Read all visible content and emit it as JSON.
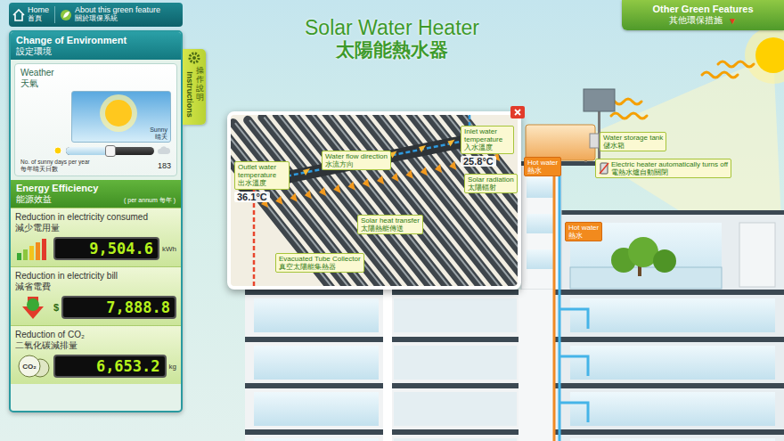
{
  "nav": [
    {
      "label": "Home",
      "label_zh": "首頁",
      "kind": "home"
    },
    {
      "label": "About this green feature",
      "label_zh": "關於環保系統",
      "kind": "about"
    }
  ],
  "title": {
    "en": "Solar Water Heater",
    "zh": "太陽能熱水器"
  },
  "other_features": {
    "label": "Other Green Features",
    "label_zh": "其他環保措施",
    "arrow": "▼"
  },
  "environment": {
    "title": "Change of Environment",
    "title_zh": "設定環境",
    "weather_label": "Weather",
    "weather_label_zh": "天氣",
    "condition": "Sunny",
    "condition_zh": "晴天",
    "slider": {
      "label": "No. of sunny days per year",
      "label_zh": "每年晴天日數",
      "value": "183",
      "level": 0.5
    }
  },
  "instructions": {
    "label": "Instructions",
    "label_zh": "操作說明"
  },
  "efficiency": {
    "title": "Energy Efficiency",
    "title_zh": "能源效益",
    "period": "( per annum 每年 )",
    "metrics": [
      {
        "kind": "electricity",
        "label": "Reduction in electricity consumed",
        "label_zh": "減少電用量",
        "value": "9,504.6",
        "unit": "kWh"
      },
      {
        "kind": "bill",
        "label": "Reduction in electricity bill",
        "label_zh": "減省電費",
        "prefix": "$",
        "value": "7,888.8"
      },
      {
        "kind": "co2",
        "label": "Reduction of CO₂",
        "label_zh": "二氧化碳減排量",
        "badge": "CO₂",
        "value": "6,653.2",
        "unit": "kg"
      }
    ]
  },
  "collector": {
    "labels": [
      {
        "kind": "outlet",
        "label": "Outlet water temperature",
        "label_zh": "出水溫度",
        "reading": "36.1°C"
      },
      {
        "kind": "flow",
        "label": "Water flow direction",
        "label_zh": "水流方向"
      },
      {
        "kind": "inlet",
        "label": "Inlet water temperature",
        "label_zh": "入水溫度",
        "reading": "25.8°C"
      },
      {
        "kind": "radiation",
        "label": "Solar radiation",
        "label_zh": "太陽輻射"
      },
      {
        "kind": "transfer",
        "label": "Solar heat transfer",
        "label_zh": "太陽熱能傳送"
      },
      {
        "kind": "tube",
        "label": "Evacuated Tube Collector",
        "label_zh": "真空太陽能集熱器"
      }
    ]
  },
  "building": {
    "labels": [
      {
        "kind": "tank",
        "label": "Water storage tank",
        "label_zh": "儲水箱"
      },
      {
        "kind": "hot-roof",
        "label": "Hot water",
        "label_zh": "熱水"
      },
      {
        "kind": "heater",
        "label": "Electric heater automatically turns off",
        "label_zh": "電熱水爐自動關閉"
      },
      {
        "kind": "hot-pipe",
        "label": "Hot water",
        "label_zh": "熱水"
      }
    ]
  }
}
